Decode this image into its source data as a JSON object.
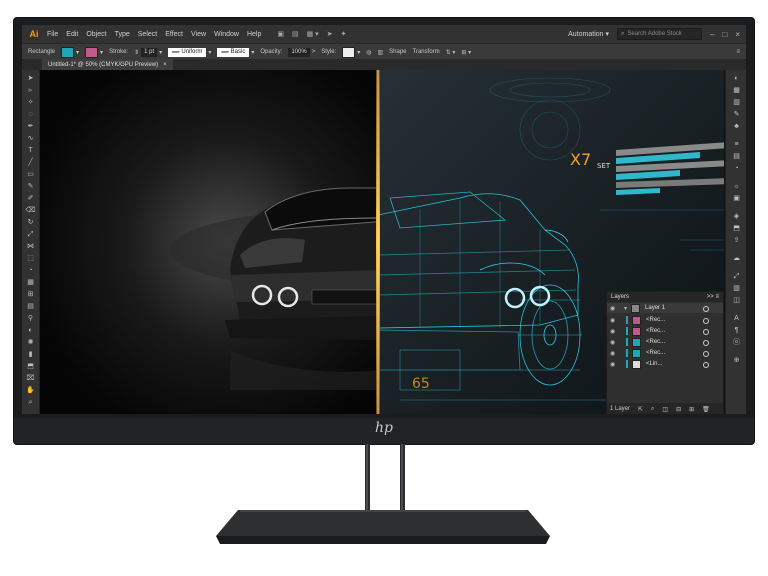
{
  "app": {
    "logo": "Ai",
    "menu": [
      "File",
      "Edit",
      "Object",
      "Type",
      "Select",
      "Effect",
      "View",
      "Window",
      "Help"
    ],
    "workspace": "Automation",
    "search_placeholder": "Search Adobe Stock"
  },
  "control_bar": {
    "object_type": "Rectangle",
    "stroke_label": "Stroke:",
    "stroke_weight": "1 pt",
    "profile": "Uniform",
    "brush": "Basic",
    "opacity_label": "Opacity:",
    "opacity_value": "100%",
    "style_label": "Style:",
    "shape_label": "Shape",
    "transform_label": "Transform",
    "fill_color": "#21a6b8",
    "stroke_color": "#c05a8a"
  },
  "document_tab": {
    "title": "Untitled-1* @ 50% (CMYK/GPU Preview)",
    "close": "×"
  },
  "artwork": {
    "model_label": "X7",
    "set_label": "SET",
    "hud_number": "65",
    "accent_color": "#2fd0ee",
    "divider_color": "#f0a020"
  },
  "layers_panel": {
    "title": "Layers",
    "expand": ">>",
    "menu": "≡",
    "rows": [
      {
        "name": "Layer 1",
        "color": "#21a6b8"
      },
      {
        "name": "<Rec...",
        "color": "#c05a8a"
      },
      {
        "name": "<Rec...",
        "color": "#c05a8a"
      },
      {
        "name": "<Rec...",
        "color": "#21a6b8"
      },
      {
        "name": "<Rec...",
        "color": "#21a6b8"
      },
      {
        "name": "<Lin...",
        "color": "#dddddd"
      }
    ],
    "footer": "1 Layer"
  },
  "monitor": {
    "brand": "hp"
  }
}
